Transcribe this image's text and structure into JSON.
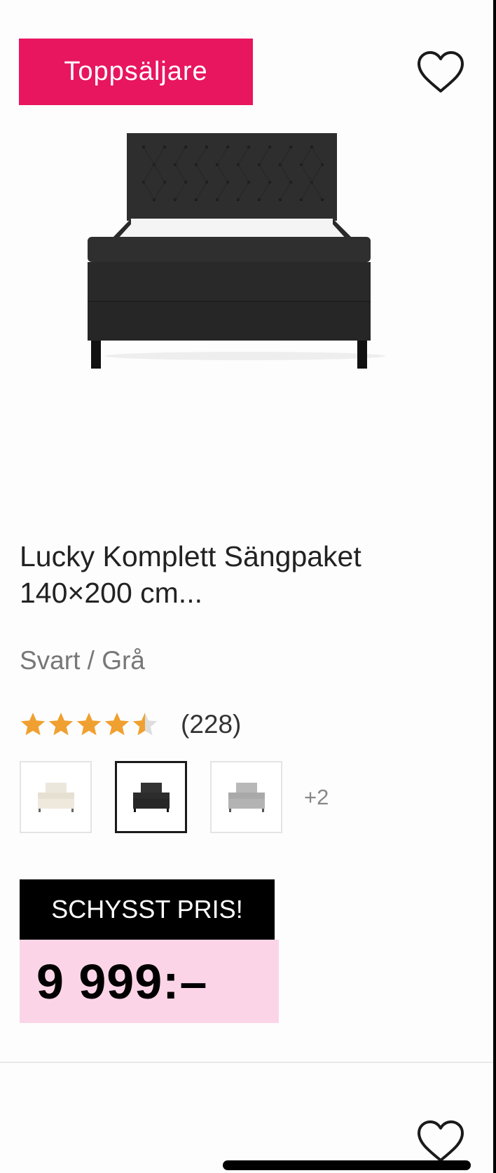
{
  "product": {
    "badge": "Toppsäljare",
    "title": "Lucky Komplett Sängpaket 140×200 cm...",
    "color": "Svart / Grå",
    "rating": {
      "value": 4.5,
      "max": 5,
      "count": "(228)"
    },
    "swatches": [
      {
        "name": "Beige",
        "selected": false
      },
      {
        "name": "Svart",
        "selected": true
      },
      {
        "name": "Grå",
        "selected": false
      }
    ],
    "more_colors": "+2",
    "promo_label": "SCHYSST PRIS!",
    "price": "9 999:–"
  },
  "colors": {
    "badge_bg": "#e8155f",
    "price_bg": "#fbd5e7",
    "star": "#f0a030",
    "star_empty": "#dddddd"
  },
  "icons": {
    "favorite": "heart-outline-icon"
  }
}
